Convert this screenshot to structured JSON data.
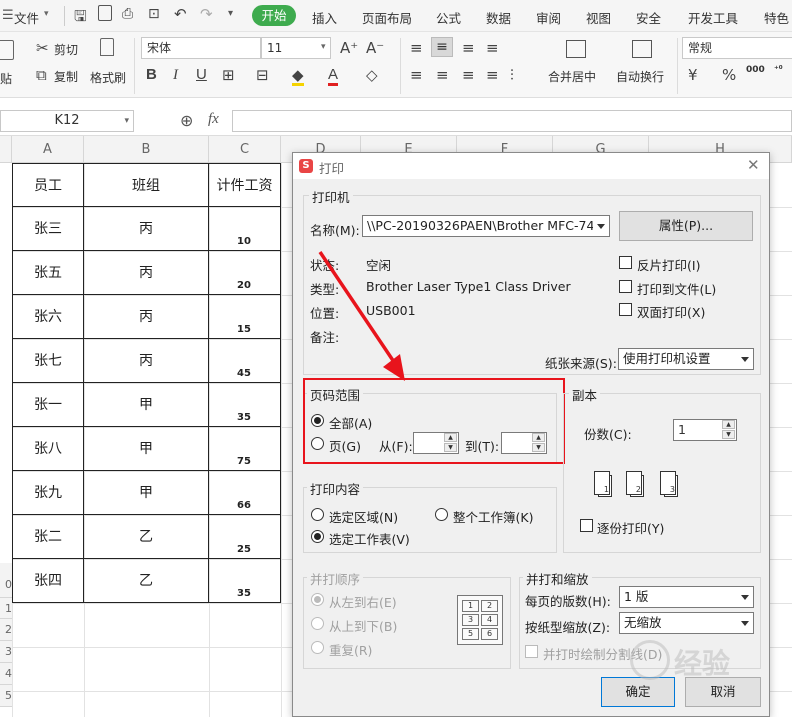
{
  "menubar": {
    "file": "文件",
    "tabs": [
      "开始",
      "插入",
      "页面布局",
      "公式",
      "数据",
      "审阅",
      "视图",
      "安全",
      "开发工具",
      "特色"
    ]
  },
  "ribbon": {
    "cut": "剪切",
    "copy": "复制",
    "paste_partial": "贴",
    "format_painter": "格式刷",
    "font": "宋体",
    "size": "11",
    "merge": "合并居中",
    "wrap": "自动换行",
    "number_format": "常规"
  },
  "formula_bar": {
    "cell_ref": "K12",
    "fx": "fx"
  },
  "sheet": {
    "col_headers": [
      "A",
      "B",
      "C",
      "D",
      "E",
      "F",
      "G",
      "H"
    ],
    "headers": [
      "员工",
      "班组",
      "计件工资"
    ],
    "rows": [
      {
        "name": "张三",
        "team": "丙",
        "pay": "10"
      },
      {
        "name": "张五",
        "team": "丙",
        "pay": "20"
      },
      {
        "name": "张六",
        "team": "丙",
        "pay": "15"
      },
      {
        "name": "张七",
        "team": "丙",
        "pay": "45"
      },
      {
        "name": "张一",
        "team": "甲",
        "pay": "35"
      },
      {
        "name": "张八",
        "team": "甲",
        "pay": "75"
      },
      {
        "name": "张九",
        "team": "甲",
        "pay": "66"
      },
      {
        "name": "张二",
        "team": "乙",
        "pay": "25"
      },
      {
        "name": "张四",
        "team": "乙",
        "pay": "35"
      }
    ],
    "row_nums": [
      "0",
      "1",
      "2",
      "3",
      "4",
      "5"
    ]
  },
  "dialog": {
    "title": "打印",
    "printer": {
      "group": "打印机",
      "name_label": "名称(M):",
      "name_value": "\\\\PC-20190326PAEN\\Brother MFC-7480",
      "properties": "属性(P)...",
      "status_label": "状态:",
      "status_value": "空闲",
      "type_label": "类型:",
      "type_value": "Brother Laser Type1 Class Driver",
      "location_label": "位置:",
      "location_value": "USB001",
      "comment_label": "备注:",
      "reverse": "反片打印(I)",
      "to_file": "打印到文件(L)",
      "duplex": "双面打印(X)",
      "source_label": "纸张来源(S):",
      "source_value": "使用打印机设置"
    },
    "range": {
      "group": "页码范围",
      "all": "全部(A)",
      "pages": "页(G)",
      "from": "从(F):",
      "to": "到(T):"
    },
    "copies": {
      "group": "副本",
      "count_label": "份数(C):",
      "count_value": "1",
      "collate": "逐份打印(Y)",
      "page_labels": [
        "1",
        "1",
        "2",
        "2",
        "3",
        "3"
      ]
    },
    "content": {
      "group": "打印内容",
      "selection": "选定区域(N)",
      "workbook": "整个工作簿(K)",
      "sheet": "选定工作表(V)"
    },
    "order": {
      "group": "并打顺序",
      "ltr": "从左到右(E)",
      "ttb": "从上到下(B)",
      "repeat": "重复(R)",
      "grid": [
        "1",
        "2",
        "3",
        "4",
        "5",
        "6"
      ]
    },
    "zoom": {
      "group": "并打和缩放",
      "per_page_label": "每页的版数(H):",
      "per_page_value": "1 版",
      "scale_label": "按纸型缩放(Z):",
      "scale_value": "无缩放",
      "draw_lines": "并打时绘制分割线(D)"
    },
    "ok": "确定",
    "cancel": "取消"
  },
  "watermark": "经验"
}
